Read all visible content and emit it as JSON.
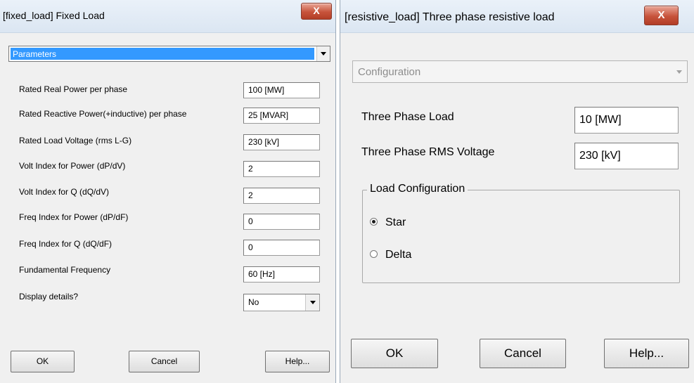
{
  "left_dialog": {
    "title": "[fixed_load] Fixed Load",
    "close_glyph": "X",
    "section_select": "Parameters",
    "params": [
      {
        "label": "Rated Real Power per phase",
        "value": "100 [MW]"
      },
      {
        "label": "Rated Reactive Power(+inductive) per phase",
        "value": "25 [MVAR]"
      },
      {
        "label": "Rated Load Voltage (rms L-G)",
        "value": "230 [kV]"
      },
      {
        "label": "Volt Index for Power (dP/dV)",
        "value": "2"
      },
      {
        "label": "Volt Index for Q (dQ/dV)",
        "value": "2"
      },
      {
        "label": "Freq Index for Power (dP/dF)",
        "value": "0"
      },
      {
        "label": "Freq Index for Q (dQ/dF)",
        "value": "0"
      },
      {
        "label": "Fundamental Frequency",
        "value": "60 [Hz]"
      }
    ],
    "display_details": {
      "label": "Display details?",
      "value": "No"
    },
    "ok": "OK",
    "cancel": "Cancel",
    "help": "Help..."
  },
  "right_dialog": {
    "title": "[resistive_load] Three phase resistive load",
    "close_glyph": "X",
    "section_select": "Configuration",
    "params": [
      {
        "label": "Three Phase Load",
        "value": "10 [MW]"
      },
      {
        "label": "Three Phase RMS Voltage",
        "value": "230 [kV]"
      }
    ],
    "group_title": "Load Configuration",
    "options": [
      {
        "label": "Star",
        "selected": true
      },
      {
        "label": "Delta",
        "selected": false
      }
    ],
    "ok": "OK",
    "cancel": "Cancel",
    "help": "Help..."
  },
  "colors": {
    "selection_blue": "#3399ff",
    "close_red": "#c7533b",
    "dialog_bg": "#f0f0f0"
  }
}
